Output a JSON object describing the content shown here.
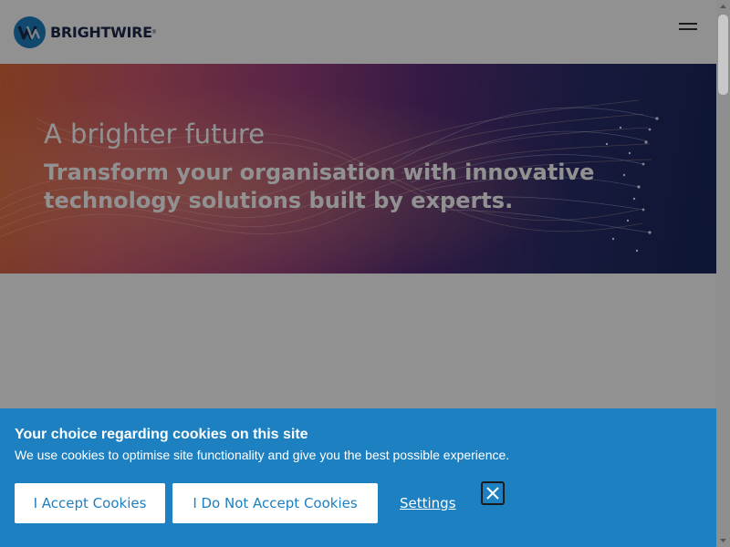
{
  "brand": {
    "name": "BRIGHTWIRE",
    "trademark": "®",
    "logo_icon": "brightwire-logo-icon",
    "color": "#1d2a4a",
    "accent": "#1d80c0"
  },
  "header": {
    "menu_icon": "hamburger-menu-icon"
  },
  "hero": {
    "title": "A brighter future",
    "subtitle": "Transform your organisation with innovative technology solutions built by experts."
  },
  "cookie_banner": {
    "title": "Your choice regarding cookies on this site",
    "text": "We use cookies to optimise site functionality and give you the best possible experience.",
    "accept_label": "I Accept Cookies",
    "decline_label": "I Do Not Accept Cookies",
    "settings_label": "Settings",
    "close_icon": "close-icon",
    "background": "#1d80c0"
  }
}
